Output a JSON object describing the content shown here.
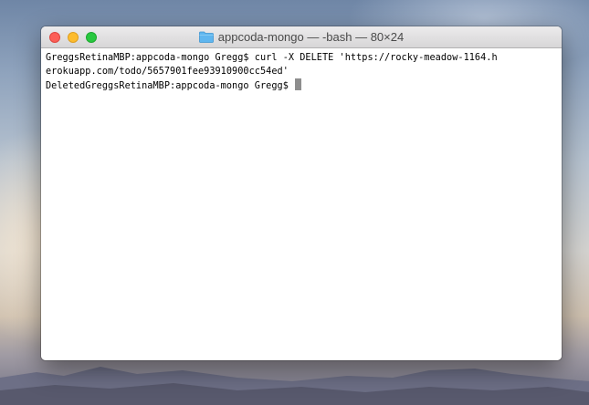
{
  "window": {
    "title": "appcoda-mongo — -bash — 80×24"
  },
  "terminal": {
    "lines": [
      "GreggsRetinaMBP:appcoda-mongo Gregg$ curl -X DELETE 'https://rocky-meadow-1164.h",
      "erokuapp.com/todo/5657901fee93910900cc54ed'",
      "DeletedGreggsRetinaMBP:appcoda-mongo Gregg$ "
    ]
  },
  "colors": {
    "close": "#fc5f57",
    "minimize": "#fdbc2e",
    "zoom": "#28c83f",
    "folder": "#5fb6ef",
    "cursor": "#8e8e8e"
  },
  "icons": {
    "title_icon": "folder-icon"
  }
}
